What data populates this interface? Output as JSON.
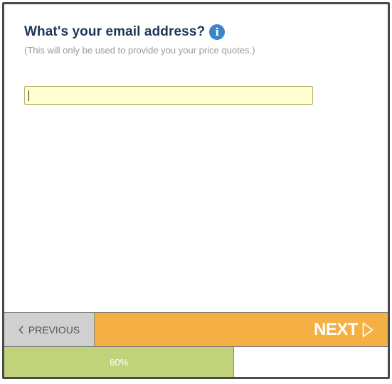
{
  "question": {
    "title": "What's your email address?",
    "info_icon": "info-icon",
    "subtitle": "(This will only be used to provide you your price quotes.)"
  },
  "email_field": {
    "value": "",
    "placeholder": ""
  },
  "navigation": {
    "previous_icon": "chevron-left-icon",
    "previous_label": "PREVIOUS",
    "next_label": "NEXT",
    "next_icon": "play-outline-icon"
  },
  "progress": {
    "percent": 60,
    "label": "60%"
  },
  "colors": {
    "title": "#1d3557",
    "info": "#3a86c8",
    "input_bg": "#ffffd2",
    "prev_bg": "#d0d0d0",
    "next_bg": "#f5b043",
    "progress_fill": "#c0d27a"
  }
}
